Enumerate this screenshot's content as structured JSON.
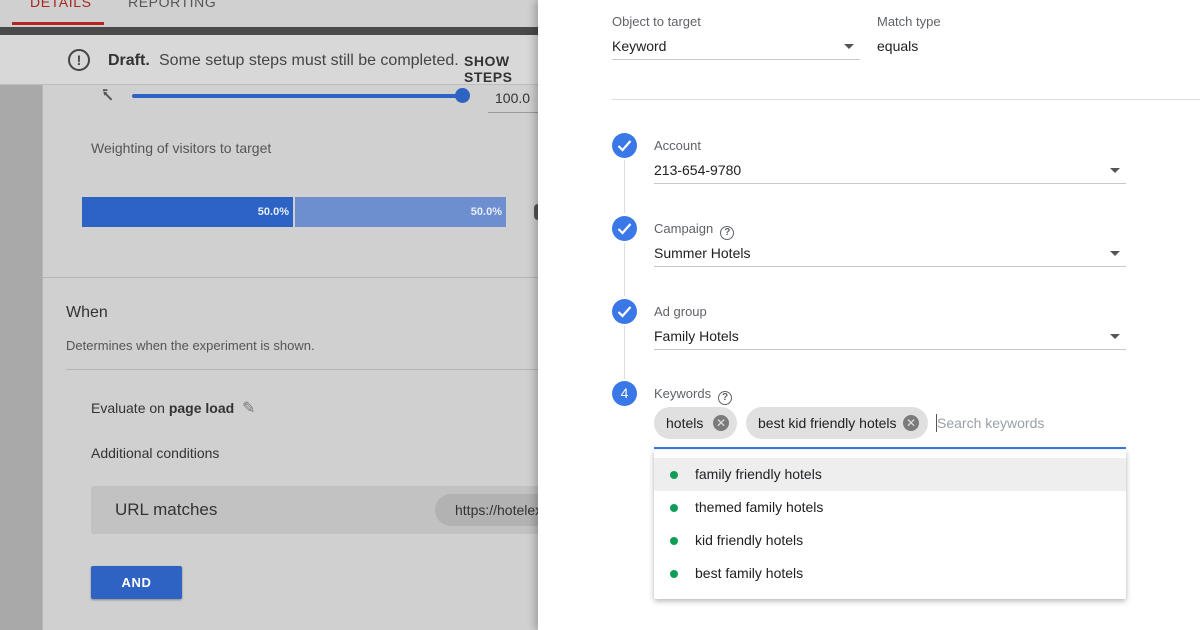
{
  "tabs": {
    "details": "DETAILS",
    "reporting": "REPORTING"
  },
  "draft": {
    "title": "Draft.",
    "message": "Some setup steps must still be completed.",
    "link": "SHOW STEPS"
  },
  "traffic": {
    "slider_value": "100.0",
    "slider_fraction": 1.0,
    "weighting_label": "Weighting of visitors to target",
    "split": [
      {
        "label": "50.0%",
        "color": "#2d63c4"
      },
      {
        "label": "50.0%",
        "color": "#6d8fd0"
      }
    ]
  },
  "when": {
    "title": "When",
    "description": "Determines when the experiment is shown.",
    "evaluate_prefix": "Evaluate on",
    "evaluate_value": "page load",
    "additional_conditions": "Additional conditions",
    "condition_label": "URL matches",
    "condition_value": "https://hotelexample.com",
    "and_button": "AND"
  },
  "panel": {
    "object_label": "Object to target",
    "object_value": "Keyword",
    "match_label": "Match type",
    "match_value": "equals",
    "steps": [
      {
        "label": "Account",
        "value": "213-654-9780",
        "status": "done"
      },
      {
        "label": "Campaign",
        "value": "Summer Hotels",
        "status": "done"
      },
      {
        "label": "Ad group",
        "value": "Family Hotels",
        "status": "done"
      }
    ],
    "keywords": {
      "step_number": "4",
      "label": "Keywords",
      "chips": [
        "hotels",
        "best kid friendly hotels"
      ],
      "placeholder": "Search keywords",
      "suggestions": [
        "family friendly hotels",
        "themed family hotels",
        "kid friendly hotels",
        "best family hotels"
      ]
    }
  },
  "colors": {
    "accent": "#3b78e7",
    "suggestion_dot": "#0f9d58",
    "tab_active": "#b1261d"
  }
}
